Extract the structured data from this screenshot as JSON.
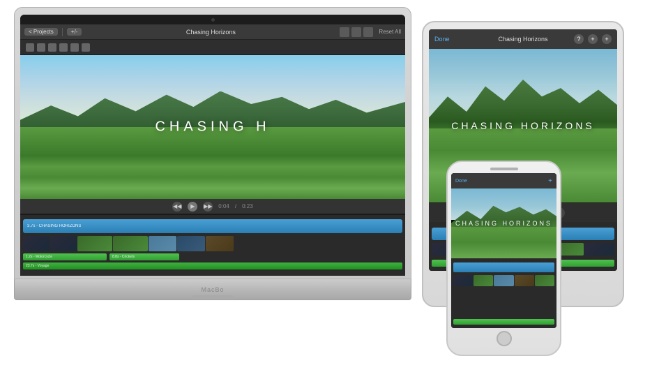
{
  "macbook": {
    "toolbar": {
      "projects_label": "< Projects",
      "add_label": "+/-",
      "title": "Chasing Horizons",
      "reset_label": "Reset All"
    },
    "preview": {
      "title_text": "CHASING H"
    },
    "timeline": {
      "time_current": "0:04",
      "time_total": "0:23",
      "track_label": "3.7s - CHASING HORIZONS",
      "audio_track1": "1.2s - Motorcycle",
      "audio_track2": "8.8s - Crickets",
      "audio_track3": "23.7s - Voyage"
    }
  },
  "ipad": {
    "toolbar": {
      "done_label": "Done",
      "title": "Chasing Horizons",
      "help_icon": "?",
      "add_icon": "+",
      "more_icon": "+"
    },
    "preview": {
      "title_text": "CHASING HORIZONS"
    }
  },
  "iphone": {
    "toolbar": {
      "done_label": "Done",
      "add_icon": "+"
    },
    "preview": {
      "title_text": "CHASING HORIZONS"
    }
  },
  "macbook_brand": "MacBo",
  "colors": {
    "blue_track": "#3a8fd4",
    "green_track": "#40b040",
    "toolbar_bg": "#3a3a3a",
    "screen_bg": "#1e1e1e",
    "device_body": "#d8d8d8"
  }
}
